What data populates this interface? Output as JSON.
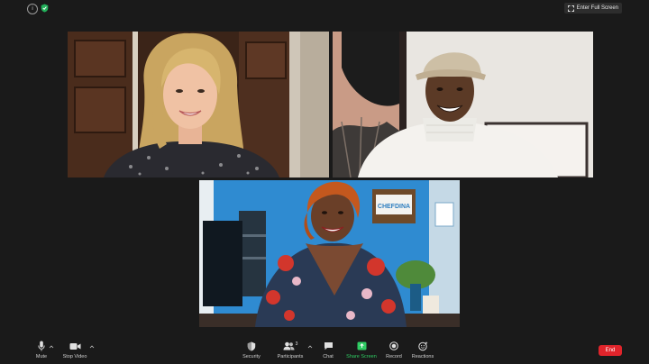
{
  "topbar": {
    "info_icon_glyph": "i",
    "fullscreen_label": "Enter Full Screen"
  },
  "toolbar": {
    "mute_label": "Mute",
    "stop_video_label": "Stop Video",
    "security_label": "Security",
    "participants_label": "Participants",
    "participants_count": "3",
    "chat_label": "Chat",
    "share_screen_label": "Share Screen",
    "record_label": "Record",
    "reactions_label": "Reactions",
    "end_label": "End"
  },
  "tiles": [
    {
      "description_icon": "video-tile"
    },
    {
      "description_icon": "video-tile"
    },
    {
      "description_icon": "video-tile"
    }
  ],
  "sign_text": "CHEFDINA",
  "colors": {
    "share_green": "#2fcc63",
    "end_red": "#e0242b",
    "background": "#1a1a1a"
  }
}
